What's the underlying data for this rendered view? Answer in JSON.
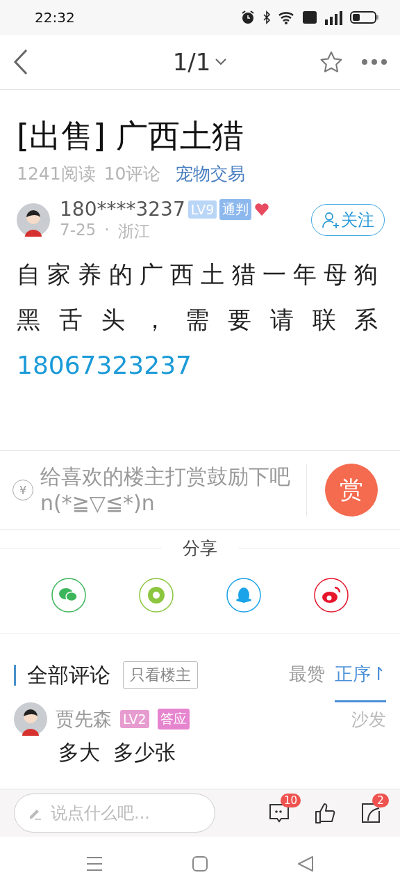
{
  "status_bar": {
    "time": "22:32"
  },
  "nav": {
    "page_indicator": "1/1"
  },
  "post": {
    "title": "[出售] 广西土猎",
    "reads": "1241阅读",
    "comment_count": "10评论",
    "category": "宠物交易",
    "author": {
      "name": "180****3237",
      "tags": [
        {
          "text": "LV9",
          "color": "#b9d6f7"
        },
        {
          "text": "通判",
          "color": "#8db8ee"
        }
      ],
      "date": "7-25",
      "separator": "·",
      "location": "浙江"
    },
    "follow_button": "关注",
    "body": "自家养的广西土猎一年母狗黑舌头，需要请联系",
    "phone": "18067323237"
  },
  "reward": {
    "currency": "¥",
    "prompt": "给喜欢的楼主打赏鼓励下吧n(*≧▽≦*)n",
    "button": "赏"
  },
  "share": {
    "title": "分享",
    "targets": [
      {
        "kind": "wechat"
      },
      {
        "kind": "moments"
      },
      {
        "kind": "qq"
      },
      {
        "kind": "weibo"
      }
    ]
  },
  "comments": {
    "header": "全部评论",
    "filter": "只看楼主",
    "sort_options": [
      {
        "label": "最赞",
        "selected": false
      },
      {
        "label": "正序↾",
        "selected": true
      }
    ],
    "items": [
      {
        "name": "贾先森",
        "tags": [
          {
            "text": "LV2",
            "color": "#e79ccf"
          },
          {
            "text": "答应",
            "color": "#e685cf"
          }
        ],
        "badge": "沙发",
        "text": "多大  多少张"
      }
    ]
  },
  "bottom_bar": {
    "placeholder": "说点什么吧...",
    "comment_badge": "10",
    "share_badge": "2"
  }
}
